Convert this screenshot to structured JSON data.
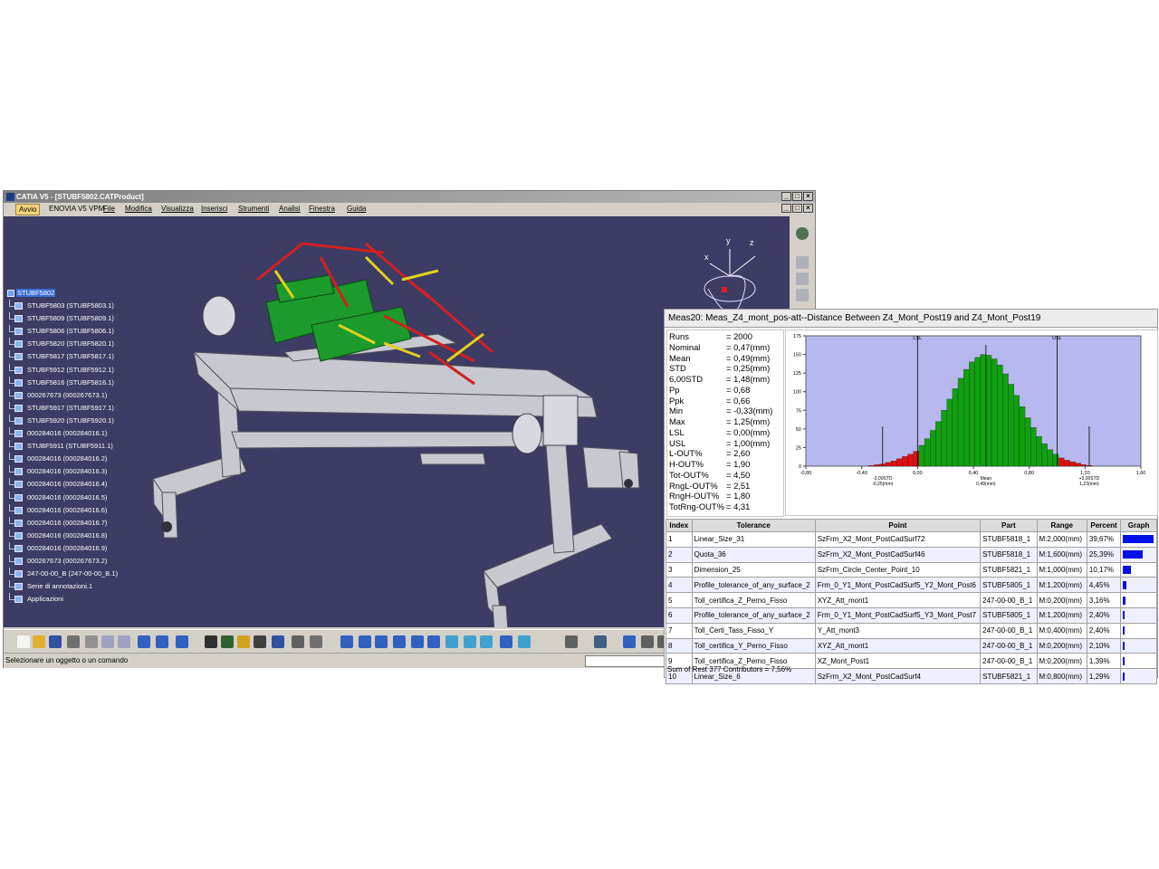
{
  "window": {
    "title": "CATIA V5 - [STUBF5802.CATProduct]",
    "controls": [
      "_",
      "□",
      "×"
    ]
  },
  "menu": {
    "items": [
      "Avvio",
      "ENOVIA V5 VPM",
      "File",
      "Modifica",
      "Visualizza",
      "Inserisci",
      "Strumenti",
      "Analisi",
      "Finestra",
      "Guida"
    ]
  },
  "tree": {
    "root": "STUBF5802",
    "nodes": [
      "STUBF5803 (STUBF5803.1)",
      "STUBF5809 (STUBF5809.1)",
      "STUBF5806 (STUBF5806.1)",
      "STUBF5820 (STUBF5820.1)",
      "STUBF5817 (STUBF5817.1)",
      "STUBF5912 (STUBF5912.1)",
      "STUBF5816 (STUBF5816.1)",
      "000267673 (000267673.1)",
      "STUBF5917 (STUBF5917.1)",
      "STUBF5920 (STUBF5920.1)",
      "000284016 (000284016.1)",
      "STUBF5911 (STUBF5911.1)",
      "000284016 (000284016.2)",
      "000284016 (000284016.3)",
      "000284016 (000284016.4)",
      "000284016 (000284016.5)",
      "000284016 (000284016.6)",
      "000284016 (000284016.7)",
      "000284016 (000284016.8)",
      "000284016 (000284016.9)",
      "000267673 (000267673.2)",
      "247-00-00_B (247-00-00_B.1)",
      "Serie di annotazioni.1",
      "Applicazioni"
    ]
  },
  "compass": {
    "axes": [
      "x",
      "y",
      "z"
    ]
  },
  "status": {
    "prompt": "Selezionare un oggetto o un comando"
  },
  "panel": {
    "title": "Meas20: Meas_Z4_mont_pos-att--Distance Between Z4_Mont_Post19 and Z4_Mont_Post19",
    "stats": [
      {
        "k": "Runs",
        "v": "= 2000"
      },
      {
        "k": "Nominal",
        "v": "= 0,47(mm)"
      },
      {
        "k": "Mean",
        "v": "= 0,49(mm)"
      },
      {
        "k": "STD",
        "v": "= 0,25(mm)"
      },
      {
        "k": "6,00STD",
        "v": "= 1,48(mm)"
      },
      {
        "k": "Pp",
        "v": "= 0,68"
      },
      {
        "k": "Ppk",
        "v": "= 0,66"
      },
      {
        "k": "Min",
        "v": "= -0,33(mm)"
      },
      {
        "k": "Max",
        "v": "= 1,25(mm)"
      },
      {
        "k": "LSL",
        "v": "= 0,00(mm)"
      },
      {
        "k": "USL",
        "v": "= 1,00(mm)"
      },
      {
        "k": "L-OUT%",
        "v": "= 2,60"
      },
      {
        "k": "H-OUT%",
        "v": "= 1,90"
      },
      {
        "k": "Tot-OUT%",
        "v": "= 4,50"
      },
      {
        "k": "RngL-OUT%",
        "v": "= 2,51"
      },
      {
        "k": "RngH-OUT%",
        "v": "= 1,80"
      },
      {
        "k": "TotRng-OUT%",
        "v": "= 4,31"
      }
    ],
    "table": {
      "headers": [
        "Index",
        "Tolerance",
        "Point",
        "Part",
        "Range",
        "Percent",
        "Graph"
      ],
      "rows": [
        {
          "index": "1",
          "tolerance": "Linear_Size_31",
          "point": "SzFrm_X2_Mont_PostCadSurf72",
          "part": "STUBF5818_1",
          "range": "M:2,000(mm)",
          "percent": "39,67%",
          "value": 39.67
        },
        {
          "index": "2",
          "tolerance": "Quota_36",
          "point": "SzFrm_X2_Mont_PostCadSurf46",
          "part": "STUBF5818_1",
          "range": "M:1,600(mm)",
          "percent": "25,39%",
          "value": 25.39
        },
        {
          "index": "3",
          "tolerance": "Dimension_25",
          "point": "SzFrm_Circle_Center_Point_10",
          "part": "STUBF5821_1",
          "range": "M:1,000(mm)",
          "percent": "10,17%",
          "value": 10.17
        },
        {
          "index": "4",
          "tolerance": "Profile_tolerance_of_any_surface_2",
          "point": "Frm_0_Y1_Mont_PostCadSurf5_Y2_Mont_Post6",
          "part": "STUBF5805_1",
          "range": "M:1,200(mm)",
          "percent": "4,45%",
          "value": 4.45
        },
        {
          "index": "5",
          "tolerance": "Toll_certifica_Z_Perno_Fisso",
          "point": "XYZ_Att_mont1",
          "part": "247-00-00_B_1",
          "range": "M:0,200(mm)",
          "percent": "3,16%",
          "value": 3.16
        },
        {
          "index": "6",
          "tolerance": "Profile_tolerance_of_any_surface_2",
          "point": "Frm_0_Y1_Mont_PostCadSurf5_Y3_Mont_Post7",
          "part": "STUBF5805_1",
          "range": "M:1,200(mm)",
          "percent": "2,40%",
          "value": 2.4
        },
        {
          "index": "7",
          "tolerance": "Toll_Certi_Tass_Fisso_Y",
          "point": "Y_Att_mont3",
          "part": "247-00-00_B_1",
          "range": "M:0,400(mm)",
          "percent": "2,40%",
          "value": 2.4
        },
        {
          "index": "8",
          "tolerance": "Toll_certifica_Y_Perno_Fisso",
          "point": "XYZ_Att_mont1",
          "part": "247-00-00_B_1",
          "range": "M:0,200(mm)",
          "percent": "2,10%",
          "value": 2.1
        },
        {
          "index": "9",
          "tolerance": "Toll_certifica_Z_Perno_Fisso",
          "point": "XZ_Mont_Post1",
          "part": "247-00-00_B_1",
          "range": "M:0,200(mm)",
          "percent": "1,39%",
          "value": 1.39
        },
        {
          "index": "10",
          "tolerance": "Linear_Size_6",
          "point": "SzFrm_X2_Mont_PostCadSurf4",
          "part": "STUBF5821_1",
          "range": "M:0,800(mm)",
          "percent": "1,29%",
          "value": 1.29
        }
      ]
    },
    "sum_rest": "Sum of Rest 377 Contributors = 7,56%"
  },
  "chart_data": {
    "type": "bar",
    "title": "",
    "x_tick_labels": [
      "-0,80",
      "-0,40",
      "0,00",
      "0,40",
      "0,80",
      "1,20",
      "1,60"
    ],
    "x_ticks": [
      -0.8,
      -0.4,
      0.0,
      0.4,
      0.8,
      1.2,
      1.6
    ],
    "y_tick_labels": [
      "0",
      "25",
      "50",
      "75",
      "100",
      "125",
      "150",
      "175"
    ],
    "xlim": [
      -0.8,
      1.6
    ],
    "ylim": [
      0,
      175
    ],
    "lsl": 0.0,
    "usl": 1.0,
    "lsl_label": "LSL",
    "usl_label": "USL",
    "mean": 0.49,
    "minus3": -0.25,
    "plus3": 1.23,
    "annotations": [
      {
        "at": -0.25,
        "lines": [
          "-3,00STD",
          "-0,25(mm)"
        ]
      },
      {
        "at": 0.49,
        "lines": [
          "Mean",
          "0,49(mm)"
        ]
      },
      {
        "at": 1.23,
        "lines": [
          "+3,00STD",
          "1,23(mm)"
        ]
      }
    ],
    "colors": {
      "bg": "#b8b8f0",
      "in": "#10a010",
      "out": "#e01010",
      "line": "#000000"
    },
    "bins": [
      {
        "x": -0.33,
        "v": 1
      },
      {
        "x": -0.29,
        "v": 2
      },
      {
        "x": -0.25,
        "v": 3
      },
      {
        "x": -0.21,
        "v": 5
      },
      {
        "x": -0.17,
        "v": 7
      },
      {
        "x": -0.13,
        "v": 10
      },
      {
        "x": -0.09,
        "v": 13
      },
      {
        "x": -0.05,
        "v": 16
      },
      {
        "x": -0.01,
        "v": 20
      },
      {
        "x": 0.03,
        "v": 28
      },
      {
        "x": 0.07,
        "v": 37
      },
      {
        "x": 0.11,
        "v": 48
      },
      {
        "x": 0.15,
        "v": 60
      },
      {
        "x": 0.19,
        "v": 75
      },
      {
        "x": 0.23,
        "v": 90
      },
      {
        "x": 0.27,
        "v": 104
      },
      {
        "x": 0.31,
        "v": 118
      },
      {
        "x": 0.35,
        "v": 130
      },
      {
        "x": 0.39,
        "v": 140
      },
      {
        "x": 0.43,
        "v": 146
      },
      {
        "x": 0.47,
        "v": 150
      },
      {
        "x": 0.51,
        "v": 149
      },
      {
        "x": 0.55,
        "v": 144
      },
      {
        "x": 0.59,
        "v": 136
      },
      {
        "x": 0.63,
        "v": 124
      },
      {
        "x": 0.67,
        "v": 110
      },
      {
        "x": 0.71,
        "v": 95
      },
      {
        "x": 0.75,
        "v": 80
      },
      {
        "x": 0.79,
        "v": 65
      },
      {
        "x": 0.83,
        "v": 52
      },
      {
        "x": 0.87,
        "v": 40
      },
      {
        "x": 0.91,
        "v": 30
      },
      {
        "x": 0.95,
        "v": 22
      },
      {
        "x": 0.99,
        "v": 16
      },
      {
        "x": 1.03,
        "v": 11
      },
      {
        "x": 1.07,
        "v": 8
      },
      {
        "x": 1.11,
        "v": 6
      },
      {
        "x": 1.15,
        "v": 4
      },
      {
        "x": 1.19,
        "v": 2
      },
      {
        "x": 1.23,
        "v": 1
      }
    ]
  }
}
